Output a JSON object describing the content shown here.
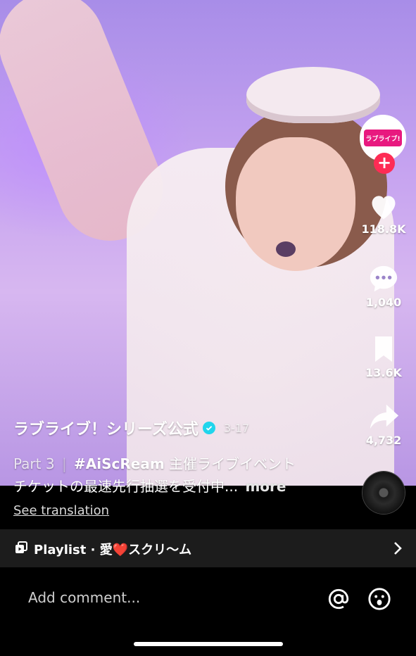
{
  "video": {
    "author": "ラブライブ！シリーズ公式",
    "date": "3-17",
    "description_part": "Part 3",
    "description_sep": "|",
    "hashtag": "#AiScReam",
    "description_line1_rest": " 主催ライブイベント",
    "description_line2": "チケットの最速先行抽選を受付中...",
    "more_label": "more",
    "see_translation": "See translation"
  },
  "actions": {
    "likes": "118.8K",
    "comments": "1,040",
    "bookmarks": "13.6K",
    "shares": "4,732",
    "follow_symbol": "+",
    "avatar_text": "ラブライブ!"
  },
  "playlist": {
    "label": "Playlist · 愛❤️スクリ～ム"
  },
  "comment": {
    "placeholder": "Add comment..."
  },
  "colors": {
    "accent_red": "#fe2c55",
    "verified": "#20d5ec"
  }
}
